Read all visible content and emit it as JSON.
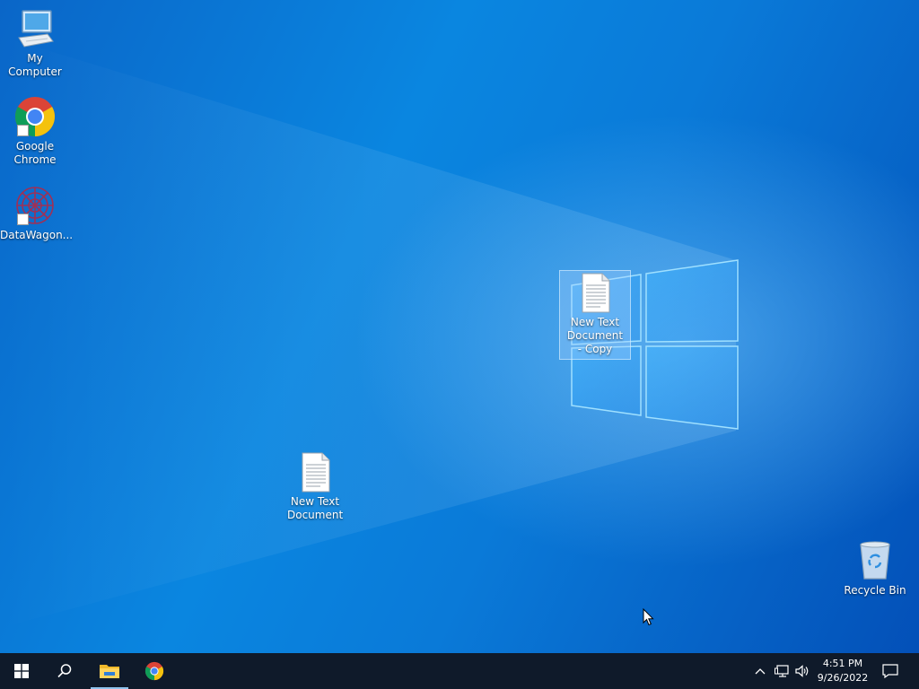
{
  "desktop": {
    "icons": [
      {
        "label": "My Computer",
        "icon": "computer-icon"
      },
      {
        "label": "Google Chrome",
        "icon": "chrome-icon",
        "shortcut": true
      },
      {
        "label": "DataWagon...",
        "icon": "datawagon-icon",
        "shortcut": true
      },
      {
        "label": "New Text Document - Copy",
        "icon": "text-document-icon",
        "selected": true
      },
      {
        "label": "New Text Document",
        "icon": "text-document-icon"
      },
      {
        "label": "Recycle Bin",
        "icon": "recycle-bin-icon"
      }
    ]
  },
  "taskbar": {
    "start_icon": "windows-logo-icon",
    "search_icon": "search-icon",
    "pinned": [
      {
        "name": "File Explorer",
        "icon": "folder-icon",
        "active": true
      },
      {
        "name": "Google Chrome",
        "icon": "chrome-icon",
        "active": false
      }
    ],
    "tray": {
      "icons": [
        "chevron-up-icon",
        "network-icon",
        "volume-icon"
      ],
      "time": "4:51 PM",
      "date": "9/26/2022",
      "notification_icon": "notification-icon"
    }
  },
  "colors": {
    "taskbar_bg": "#0f1a2a",
    "desktop_accent": "#0a78d7",
    "active_indicator": "#8fc3ee"
  }
}
